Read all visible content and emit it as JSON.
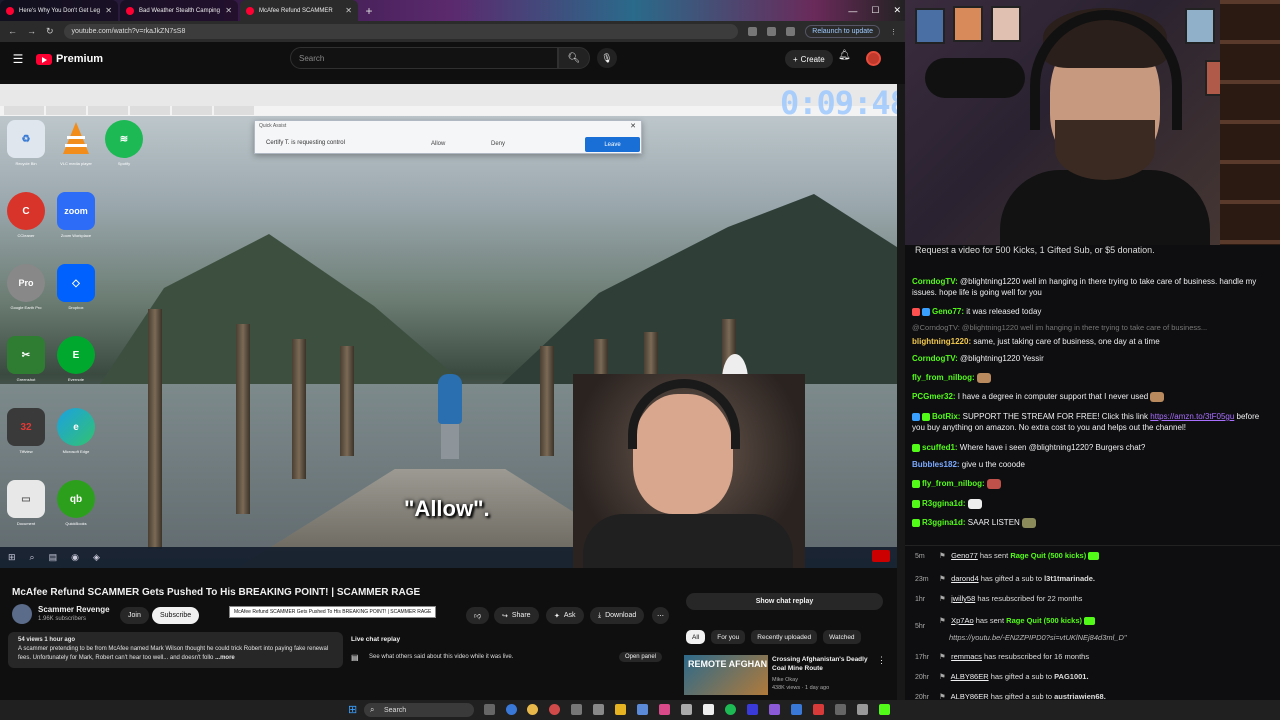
{
  "browser": {
    "tabs": [
      {
        "title": "Here's Why You Don't Get Leg"
      },
      {
        "title": "Bad Weather Stealth Camping"
      },
      {
        "title": "McAfee Refund SCAMMER"
      }
    ],
    "url": "youtube.com/watch?v=rkaJkZN7sS8",
    "relaunch_label": "Relaunch to update"
  },
  "youtube": {
    "logo_text": "Premium",
    "search_placeholder": "Search",
    "create_label": "Create",
    "video_title": "McAfee Refund SCAMMER Gets Pushed To His BREAKING POINT! | SCAMMER RAGE",
    "tooltip": "McAfee Refund SCAMMER Gets Pushed To His BREAKING POINT! | SCAMMER RAGE",
    "channel_name": "Scammer Revenge",
    "channel_subs": "1.96K subscribers",
    "join_label": "Join",
    "subscribe_label": "Subscribe",
    "share_label": "Share",
    "ask_label": "Ask",
    "download_label": "Download",
    "desc_meta": "54 views  1 hour ago",
    "desc_text": "A scammer pretending to be from McAfee named Mark Wilson thought he could trick Robert into paying fake renewal fees. Unfortunately for Mark, Robert can't hear too well... and doesn't follo",
    "desc_more": "...more",
    "live_chat_header": "Live chat replay",
    "live_chat_sub": "See what others said about this video while it was live.",
    "open_panel": "Open panel",
    "show_chat": "Show chat replay",
    "chips": [
      "All",
      "For you",
      "Recently uploaded",
      "Watched"
    ],
    "rec_thumb_text": "REMOTE AFGHAN",
    "rec_title": "Crossing Afghanistan's Deadly Coal Mine Route",
    "rec_channel": "Mike Okay",
    "rec_stats": "438K views · 1 day ago"
  },
  "video": {
    "timer": "0:09:48",
    "caption": "\"Allow\".",
    "quick_assist_title": "Quick Assist",
    "quick_assist_msg": "Certify T. is requesting control",
    "allow": "Allow",
    "deny": "Deny",
    "leave": "Leave",
    "desktop_icons": [
      "Recycle Bin",
      "VLC media player",
      "Spotify",
      "CCleaner",
      "Zoom Workplace",
      "Google Earth Pro",
      "Dropbox",
      "Greenshot",
      "Evernote",
      "Tiffview",
      "Microsoft Edge",
      "Document",
      "QuickBooks"
    ],
    "zoom_text": "zoom",
    "pro_text": "Pro"
  },
  "taskbar": {
    "search_label": "Search"
  },
  "chat": {
    "banner": "Request a video for 500 Kicks, 1 Gifted Sub, or $5 donation.",
    "messages": [
      {
        "user": "CorndogTV:",
        "text": " @blightning1220 well im hanging in there trying to take care of business. handle my issues. hope life is going well for you",
        "color": "#53fc18"
      },
      {
        "user": "Geno77:",
        "text": " it was released today",
        "color": "#53fc18"
      },
      {
        "user": "",
        "text": "@CorndogTV: @blightning1220 well im hanging in there trying to take care of business...",
        "color": "#777"
      },
      {
        "user": "blightning1220:",
        "text": " same, just taking care of business, one day at a time",
        "color": "#f2c94c"
      },
      {
        "user": "CorndogTV:",
        "text": " @blightning1220 Yessir",
        "color": "#53fc18"
      },
      {
        "user": "fly_from_nilbog:",
        "text": "",
        "color": "#53fc18"
      },
      {
        "user": "PCGmer32:",
        "text": " I have a degree in computer support that I never used",
        "color": "#53fc18"
      },
      {
        "user": "BotRix:",
        "text": " SUPPORT THE STREAM FOR FREE! Click this link ",
        "link": "https://amzn.to/3tF05gu",
        "text2": " before you buy anything on amazon. No extra cost to you and helps out the channel!",
        "color": "#53fc18"
      },
      {
        "user": "scuffed1:",
        "text": " Where have i seen @blightning1220? Burgers chat?",
        "color": "#53fc18"
      },
      {
        "user": "Bubbles182:",
        "text": " give u the cooode",
        "color": "#7aa9ff"
      },
      {
        "user": "fly_from_nilbog:",
        "text": "",
        "color": "#53fc18"
      },
      {
        "user": "R3ggina1d:",
        "text": "",
        "color": "#53fc18"
      },
      {
        "user": "R3ggina1d:",
        "text": " SAAR LISTEN",
        "color": "#53fc18"
      }
    ],
    "events": [
      {
        "time": "5m",
        "name": "Geno77",
        "text": " has sent ",
        "bold": "Rage Quit (500 kicks)",
        "kick": true
      },
      {
        "time": "23m",
        "name": "darond4",
        "text": " has gifted a sub to ",
        "bold": "l3t1tmarinade."
      },
      {
        "time": "1hr",
        "name": "jwilly58",
        "text": " has resubscribed for 22 months"
      },
      {
        "time": "5hr",
        "name": "Xp7Ao",
        "text": " has sent ",
        "bold": "Rage Quit (500 kicks)",
        "kick": true,
        "sub": "https://youtu.be/-EN2ZPIPD0?si=vtUKlNEj84d3ml_D\""
      },
      {
        "time": "17hr",
        "name": "remmacs",
        "text": " has resubscribed for 16 months"
      },
      {
        "time": "20hr",
        "name": "ALBY86ER",
        "text": " has gifted a sub to ",
        "bold": "PAG1001."
      },
      {
        "time": "20hr",
        "name": "ALBY86ER",
        "text": " has gifted a sub to ",
        "bold": "austriawien68."
      },
      {
        "time": "20hr",
        "name": "ALBY86ER",
        "text": " has gifted a sub to ",
        "bold": "MoB574J."
      }
    ]
  },
  "colors": {
    "yt_red": "#ff0033",
    "kick_green": "#53fc18",
    "leave_blue": "#1a6fd6"
  }
}
